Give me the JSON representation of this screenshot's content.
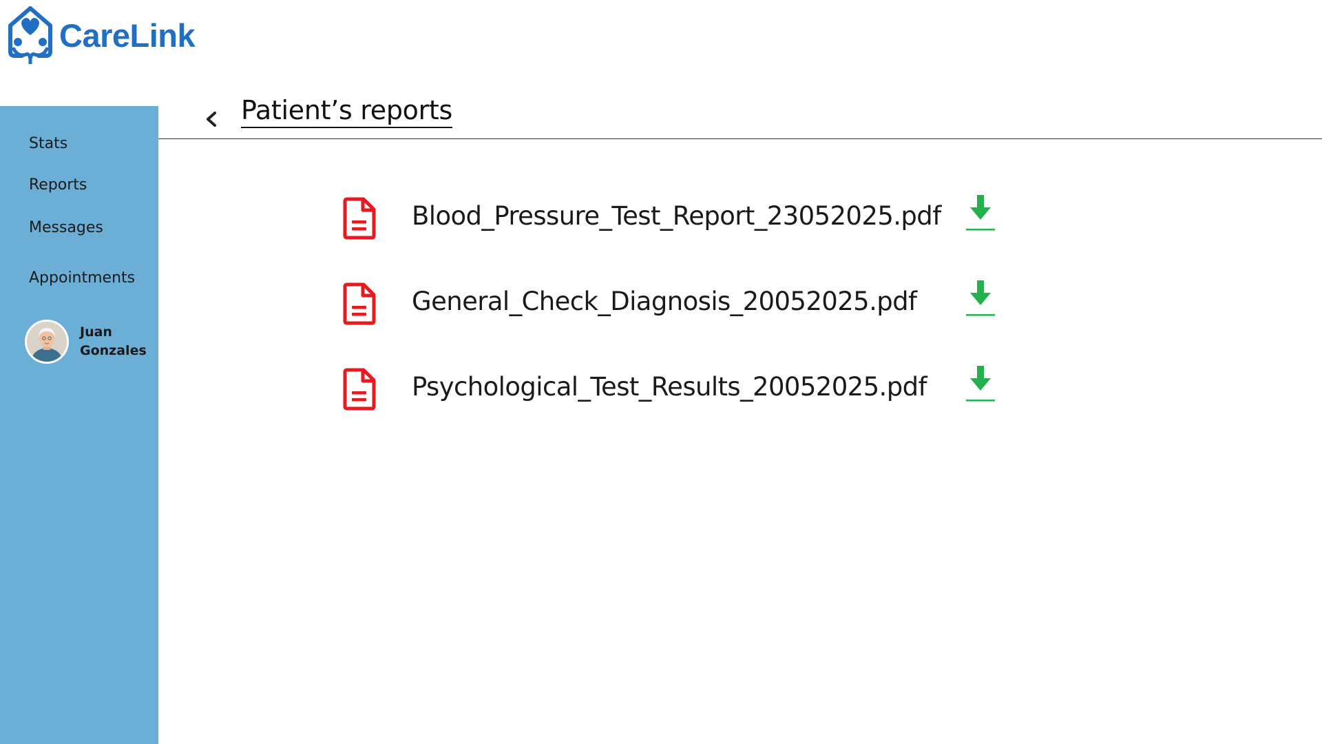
{
  "brand": {
    "name": "CareLink",
    "logo_icon": "house-heart-logo-icon",
    "color": "#1f6fc4"
  },
  "sidebar": {
    "background": "#6baed6",
    "items": [
      {
        "label": "Stats"
      },
      {
        "label": "Reports"
      },
      {
        "label": "Messages"
      },
      {
        "label": "Appointments"
      }
    ],
    "user": {
      "first_name": "Juan",
      "last_name": "Gonzales",
      "avatar_icon": "elderly-man-avatar"
    }
  },
  "header": {
    "back_icon": "chevron-left-icon",
    "title": "Patient’s reports"
  },
  "files": [
    {
      "name": "Blood_Pressure_Test_Report_23052025.pdf",
      "icon": "pdf-file-icon",
      "action_icon": "download-icon"
    },
    {
      "name": "General_Check_Diagnosis_20052025.pdf",
      "icon": "pdf-file-icon",
      "action_icon": "download-icon"
    },
    {
      "name": "Psychological_Test_Results_20052025.pdf",
      "icon": "pdf-file-icon",
      "action_icon": "download-icon"
    }
  ],
  "colors": {
    "file_icon": "#e8191f",
    "download_icon": "#22b14c"
  }
}
